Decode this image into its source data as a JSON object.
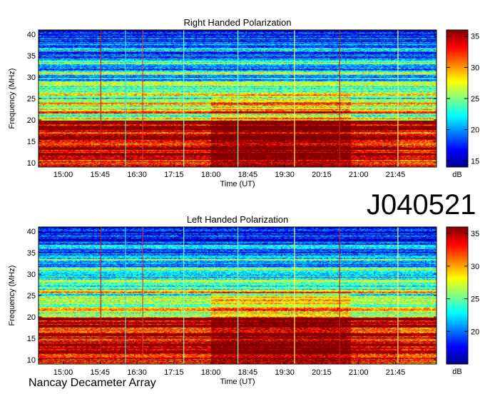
{
  "observation_id": "J040521",
  "footer": "Nancay Decameter Array",
  "chart_data": [
    {
      "type": "heatmap",
      "title": "Right Handed Polarization",
      "xlabel": "Time (UT)",
      "ylabel": "Frequency (MHz)",
      "x_ticks": [
        "15:00",
        "15:45",
        "16:30",
        "17:15",
        "18:00",
        "18:45",
        "19:30",
        "20:15",
        "21:00",
        "21:45"
      ],
      "x_tick_minutes": [
        900,
        945,
        990,
        1035,
        1080,
        1125,
        1170,
        1215,
        1260,
        1305
      ],
      "xlim_minutes": [
        870,
        1355
      ],
      "y_ticks": [
        10,
        15,
        20,
        25,
        30,
        35,
        40
      ],
      "ylim": [
        9,
        41
      ],
      "colorbar": {
        "label": "dB",
        "ticks": [
          15,
          20,
          25,
          30,
          35
        ],
        "range": [
          14,
          36
        ]
      }
    },
    {
      "type": "heatmap",
      "title": "Left Handed Polarization",
      "xlabel": "Time (UT)",
      "ylabel": "Frequency (MHz)",
      "x_ticks": [
        "15:00",
        "15:45",
        "16:30",
        "17:15",
        "18:00",
        "18:45",
        "19:30",
        "20:15",
        "21:00",
        "21:45"
      ],
      "x_tick_minutes": [
        900,
        945,
        990,
        1035,
        1080,
        1125,
        1170,
        1215,
        1260,
        1305
      ],
      "xlim_minutes": [
        870,
        1355
      ],
      "y_ticks": [
        10,
        15,
        20,
        25,
        30,
        35,
        40
      ],
      "ylim": [
        9,
        41
      ],
      "colorbar": {
        "label": "dB",
        "ticks": [
          20,
          25,
          30,
          35
        ],
        "range": [
          15,
          36
        ]
      }
    }
  ]
}
